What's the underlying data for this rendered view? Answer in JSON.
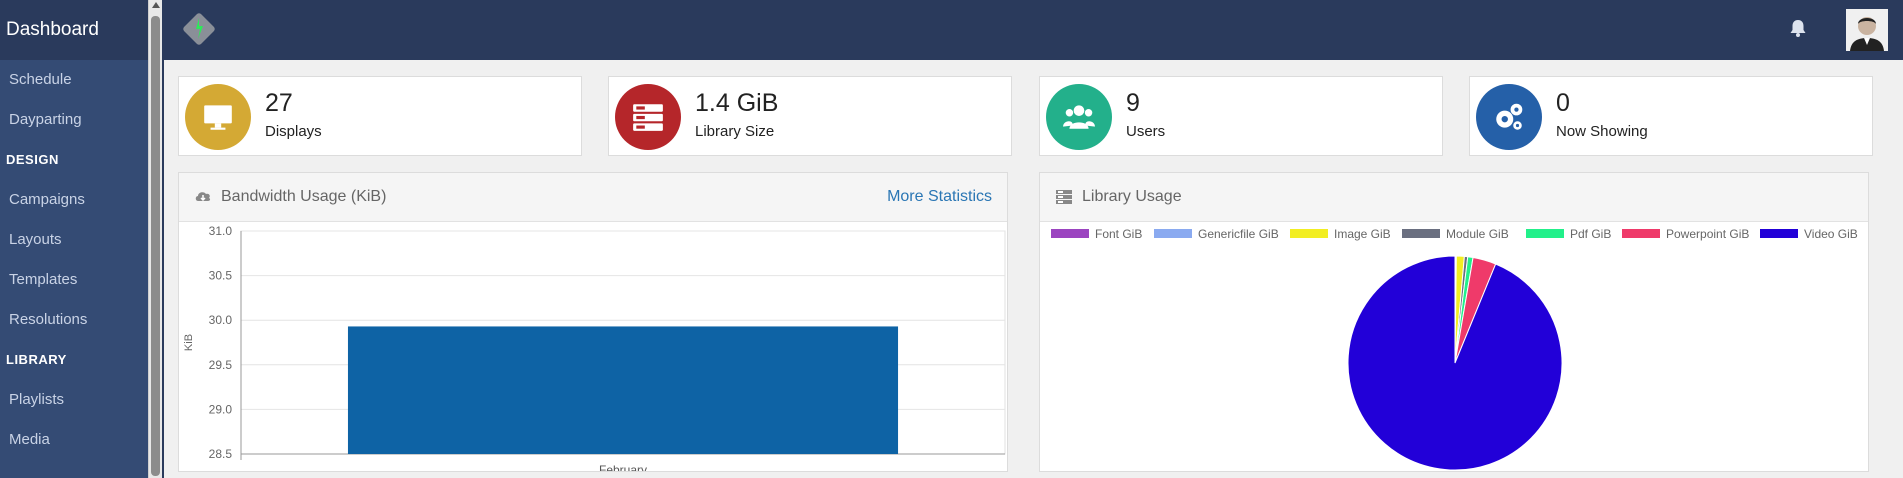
{
  "sidebar": {
    "brand": "Dashboard",
    "items": [
      {
        "type": "item",
        "label": "Schedule"
      },
      {
        "type": "item",
        "label": "Dayparting"
      },
      {
        "type": "section",
        "label": "DESIGN"
      },
      {
        "type": "item",
        "label": "Campaigns"
      },
      {
        "type": "item",
        "label": "Layouts"
      },
      {
        "type": "item",
        "label": "Templates"
      },
      {
        "type": "item",
        "label": "Resolutions"
      },
      {
        "type": "section",
        "label": "LIBRARY"
      },
      {
        "type": "item",
        "label": "Playlists"
      },
      {
        "type": "item",
        "label": "Media"
      }
    ]
  },
  "cards": [
    {
      "value": "27",
      "label": "Displays",
      "color": "#d4a934",
      "icon": "monitor-icon"
    },
    {
      "value": "1.4 GiB",
      "label": "Library Size",
      "color": "#b5262a",
      "icon": "server-icon"
    },
    {
      "value": "9",
      "label": "Users",
      "color": "#23b08b",
      "icon": "users-icon"
    },
    {
      "value": "0",
      "label": "Now Showing",
      "color": "#2560a8",
      "icon": "gears-icon"
    }
  ],
  "bandwidth": {
    "title": "Bandwidth Usage (KiB)",
    "link": "More Statistics"
  },
  "library": {
    "title": "Library Usage"
  },
  "chart_data": [
    {
      "type": "bar",
      "categories": [
        "February"
      ],
      "values": [
        29.93
      ],
      "ylabel": "KiB",
      "ylim": [
        28.5,
        31.0
      ],
      "yticks": [
        "28.5",
        "29.0",
        "29.5",
        "30.0",
        "30.5",
        "31.0"
      ],
      "color": "#0e63a5",
      "grid": true
    },
    {
      "type": "pie",
      "legend_position": "top",
      "labels": [
        "Font GiB",
        "Genericfile GiB",
        "Image GiB",
        "Module GiB",
        "Pdf GiB",
        "Powerpoint GiB",
        "Video GiB"
      ],
      "colors": [
        "#9b44c0",
        "#8aaaf0",
        "#f2ee22",
        "#6a6f80",
        "#22f08a",
        "#ef3a6a",
        "#2200d8"
      ],
      "values": [
        0.1,
        0.1,
        1.2,
        0.5,
        0.8,
        3.5,
        93.8
      ]
    }
  ]
}
